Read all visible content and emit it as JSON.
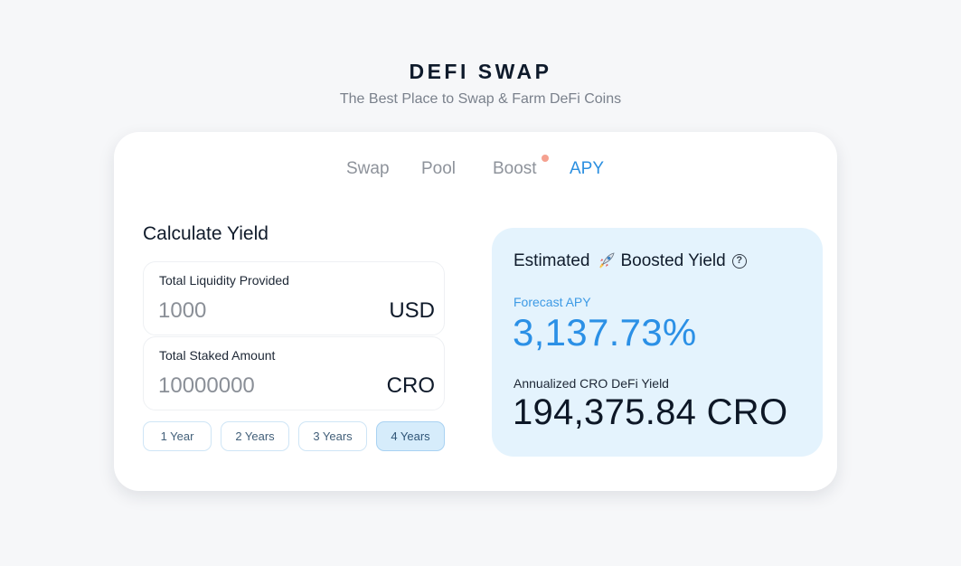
{
  "header": {
    "brand": "DEFI SWAP",
    "tagline": "The Best Place to Swap & Farm DeFi Coins"
  },
  "tabs": [
    {
      "label": "Swap",
      "active": false
    },
    {
      "label": "Pool",
      "active": false
    },
    {
      "label": "Boost",
      "active": false,
      "notification_dot": true
    },
    {
      "label": "APY",
      "active": true
    }
  ],
  "calculator": {
    "title": "Calculate Yield",
    "liquidity": {
      "label": "Total Liquidity Provided",
      "value": "1000",
      "unit": "USD"
    },
    "staked": {
      "label": "Total Staked Amount",
      "value": "10000000",
      "unit": "CRO"
    },
    "durations": [
      {
        "label": "1 Year",
        "selected": false
      },
      {
        "label": "2 Years",
        "selected": false
      },
      {
        "label": "3 Years",
        "selected": false
      },
      {
        "label": "4 Years",
        "selected": true
      }
    ]
  },
  "yield": {
    "title_prefix": "Estimated",
    "title_suffix": "Boosted Yield",
    "rocket_icon": "rocket-icon",
    "help_icon": "question-circle-icon",
    "forecast_label": "Forecast APY",
    "forecast_value": "3,137.73%",
    "annualized_label": "Annualized CRO DeFi Yield",
    "annualized_value": "194,375.84 CRO"
  },
  "colors": {
    "accent": "#2b90e6",
    "yield_bg": "#e4f3fd",
    "notification_dot": "#f5a190",
    "page_bg": "#f6f7f9"
  }
}
